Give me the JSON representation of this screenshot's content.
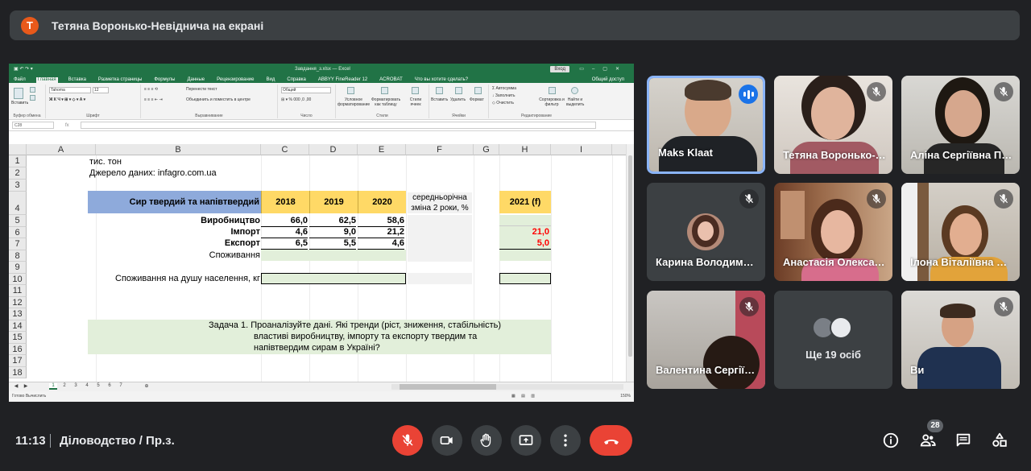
{
  "presenter": {
    "initial": "Т",
    "text": "Тетяна Воронько-Невіднича на екрані"
  },
  "excel": {
    "filename": "Завдання_з.xlsx — Excel",
    "login": "Вход",
    "ribbon_tabs": [
      "Файл",
      "Главная",
      "Вставка",
      "Разметка страницы",
      "Формулы",
      "Данные",
      "Рецензирование",
      "Вид",
      "Справка",
      "ABBYY FineReader 12",
      "ACROBAT",
      "Что вы хотите сделать?"
    ],
    "share": "Общий доступ",
    "ribbon": {
      "paste": "Вставить",
      "font_name": "Tahoma",
      "font_size": "12",
      "wrap": "Перенести текст",
      "merge": "Объединить и поместить в центре",
      "number_format": "Общий",
      "cond_format": "Условное форматирование",
      "format_table": "Форматировать как таблицу",
      "cell_styles": "Стили ячеек",
      "insert": "Вставить",
      "delete": "Удалить",
      "format": "Формат",
      "autosum": "Автосумма",
      "fill": "Заполнить",
      "clear": "Очистить",
      "sort": "Сортировка и фильтр",
      "find": "Найти и выделить",
      "groups": [
        "Буфер обмена",
        "Шрифт",
        "Выравнивание",
        "Число",
        "Стили",
        "Ячейки",
        "Редактирование"
      ]
    },
    "namebox": "C28",
    "fx": "fx",
    "columns": [
      "A",
      "B",
      "C",
      "D",
      "E",
      "F",
      "G",
      "H",
      "I"
    ],
    "rows": [
      "1",
      "2",
      "3",
      "4",
      "5",
      "6",
      "7",
      "8",
      "9",
      "10",
      "11",
      "12",
      "13",
      "14",
      "15",
      "16",
      "17",
      "18"
    ],
    "cells": {
      "r1": "тис. тон",
      "r2": "Джерело даних: infagro.com.ua",
      "header_label": "Сир твердий та напівтвердий",
      "y2018": "2018",
      "y2019": "2019",
      "y2020": "2020",
      "avg_change": "середньорічна зміна 2 роки, %",
      "y2021": "2021 (f)",
      "production": "Виробництво",
      "import": "Імпорт",
      "export": "Експорт",
      "consumption": "Споживання",
      "consumption_pc": "Споживання на душу населення, кг",
      "prod_2018": "66,0",
      "prod_2019": "62,5",
      "prod_2020": "58,6",
      "imp_2018": "4,6",
      "imp_2019": "9,0",
      "imp_2020": "21,2",
      "imp_2021": "21,0",
      "exp_2018": "6,5",
      "exp_2019": "5,5",
      "exp_2020": "4,6",
      "exp_2021": "5,0",
      "task_line1": "Задача 1. Проаналізуйте дані. Які тренди (ріст, зниження, стабільність)",
      "task_line2": "властиві виробництву, імпорту та експорту твердим та",
      "task_line3": "напівтвердим сирам в Україні?"
    },
    "sheet_tabs": [
      "1",
      "2",
      "3",
      "4",
      "5",
      "6",
      "7"
    ],
    "status": "Готово   Вычислить",
    "zoom": "150%"
  },
  "participants": [
    {
      "name": "Maks Klaat",
      "speaking": true
    },
    {
      "name": "Тетяна Воронько-Невіднича",
      "muted": true
    },
    {
      "name": "Аліна Сергіївна Петренко",
      "muted": true
    },
    {
      "name": "Карина Володимирівна",
      "muted": true
    },
    {
      "name": "Анастасія Олександрівна",
      "muted": true
    },
    {
      "name": "Ілона Віталіївна Коваль",
      "muted": true
    },
    {
      "name": "Валентина Сергіївна",
      "muted": true
    },
    {
      "name": "Ще 19 осіб"
    },
    {
      "name": "Ви",
      "muted": true
    }
  ],
  "bottom": {
    "time": "11:13",
    "meeting": "Діловодство / Пр.з.",
    "people_count": "28"
  },
  "colors": {
    "excel_green": "#217346",
    "header_blue": "#8eaadb",
    "year_yellow": "#ffd966",
    "light_green": "#e2efda",
    "red": "#ff0000",
    "end_call": "#ea4335"
  }
}
